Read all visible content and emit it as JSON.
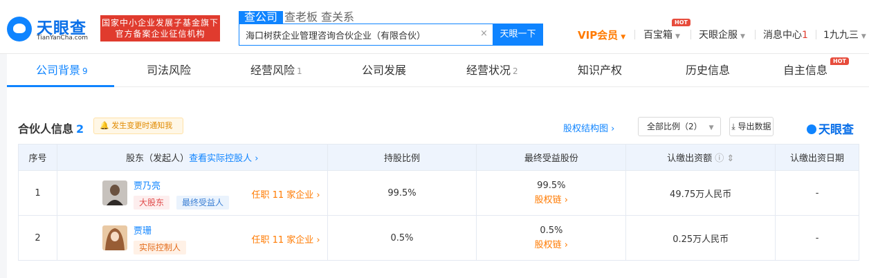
{
  "header": {
    "logo_text": "天眼查",
    "logo_sub": "TianYanCha.com",
    "gov_badge_line1": "国家中小企业发展子基金旗下",
    "gov_badge_line2": "官方备案企业征信机构",
    "search_tabs": [
      "查公司",
      "查老板",
      "查关系"
    ],
    "search_value": "海口树获企业管理咨询合伙企业（有限合伙）",
    "search_clear": "×",
    "search_button": "天眼一下",
    "vip": "VIP会员",
    "treasure": "百宝箱",
    "hot": "HOT",
    "enterprise": "天眼企服",
    "messages": "消息中心",
    "message_count": "1",
    "user": "1九九三"
  },
  "tabs": [
    {
      "label": "公司背景",
      "count": "9"
    },
    {
      "label": "司法风险",
      "count": ""
    },
    {
      "label": "经营风险",
      "count": "1"
    },
    {
      "label": "公司发展",
      "count": ""
    },
    {
      "label": "经营状况",
      "count": "2"
    },
    {
      "label": "知识产权",
      "count": ""
    },
    {
      "label": "历史信息",
      "count": ""
    },
    {
      "label": "自主信息",
      "count": ""
    }
  ],
  "tab_hot": "HOT",
  "section": {
    "title": "合伙人信息",
    "count": "2",
    "notify": "发生变更时通知我",
    "equity_link": "股权结构图",
    "ratio_select": "全部比例（2）",
    "export": "导出数据",
    "watermark": "天眼查"
  },
  "table": {
    "headers": {
      "index": "序号",
      "holder": "股东（发起人）",
      "holder_link": "查看实际控股人",
      "ratio": "持股比例",
      "final": "最终受益股份",
      "capital": "认缴出资额",
      "date": "认缴出资日期"
    },
    "rows": [
      {
        "index": "1",
        "name": "贾乃亮",
        "tags": [
          "大股东",
          "最终受益人"
        ],
        "posts": "任职 11 家企业",
        "ratio": "99.5%",
        "final": "99.5%",
        "chain": "股权链",
        "capital": "49.75万人民币",
        "date": "-"
      },
      {
        "index": "2",
        "name": "贾珊",
        "tags": [
          "实际控制人"
        ],
        "posts": "任职 11 家企业",
        "ratio": "0.5%",
        "final": "0.5%",
        "chain": "股权链",
        "capital": "0.25万人民币",
        "date": "-"
      }
    ]
  }
}
